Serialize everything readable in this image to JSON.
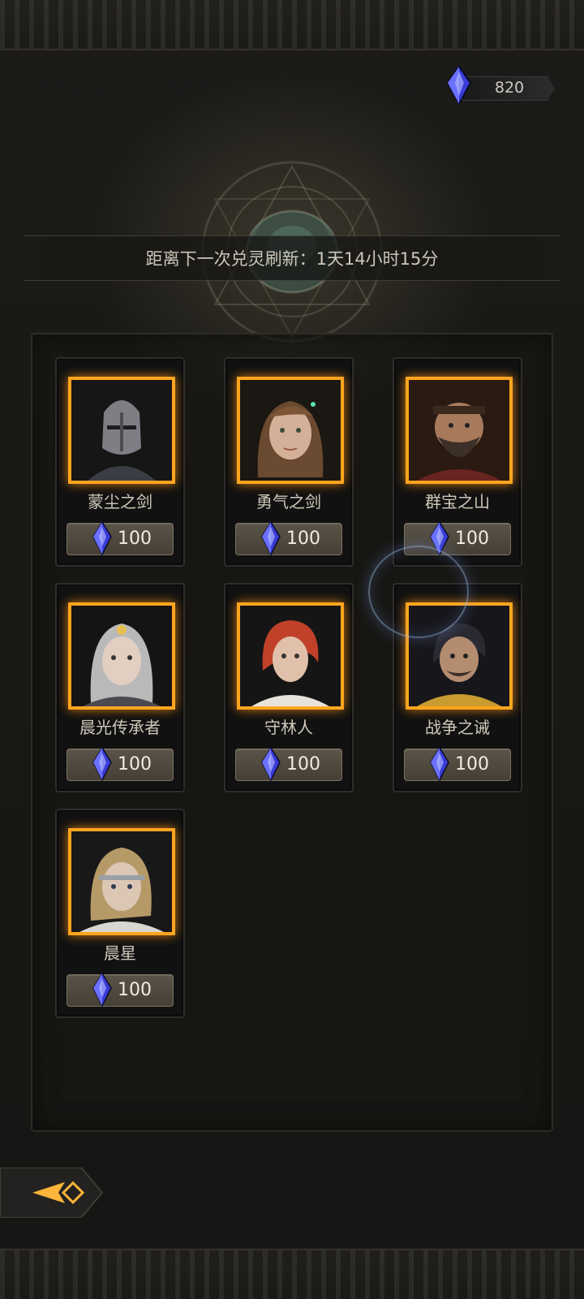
{
  "currency": {
    "icon": "blue-crystal-icon",
    "amount": "820"
  },
  "refresh": {
    "text": "距离下一次兑灵刷新：1天14小时15分"
  },
  "heroes": [
    {
      "name": "蒙尘之剑",
      "price": "100",
      "portrait": "armored-knight-portrait"
    },
    {
      "name": "勇气之剑",
      "price": "100",
      "portrait": "young-woman-portrait"
    },
    {
      "name": "群宝之山",
      "price": "100",
      "portrait": "bearded-warrior-portrait"
    },
    {
      "name": "晨光传承者",
      "price": "100",
      "portrait": "silver-haired-knight-portrait"
    },
    {
      "name": "守林人",
      "price": "100",
      "portrait": "red-haired-ranger-portrait"
    },
    {
      "name": "战争之诫",
      "price": "100",
      "portrait": "scarred-mercenary-portrait"
    },
    {
      "name": "晨星",
      "price": "100",
      "portrait": "blonde-warrior-portrait"
    }
  ],
  "colors": {
    "frame_glow": "#ffa51e",
    "price_button": "#4f4a40",
    "crystal": "#5a5cff"
  },
  "back_button": {
    "icon": "back-arrow-icon"
  }
}
